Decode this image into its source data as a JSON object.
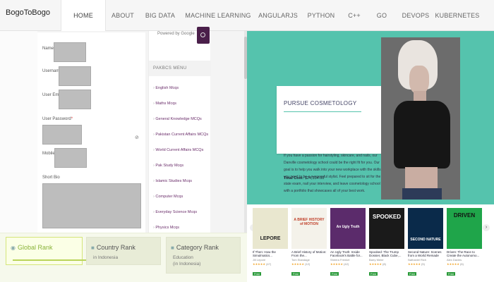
{
  "nav": {
    "brand": "BogoToBogo",
    "items": [
      {
        "label": "HOME",
        "active": true
      },
      {
        "label": "ABOUT"
      },
      {
        "label": "BIG DATA"
      },
      {
        "label": "MACHINE LEARNING"
      },
      {
        "label": "ANGULARJS"
      },
      {
        "label": "PYTHON"
      },
      {
        "label": "C++"
      },
      {
        "label": "GO"
      },
      {
        "label": "DEVOPS"
      },
      {
        "label": "KUBERNETES"
      }
    ]
  },
  "form": {
    "fields": [
      {
        "label": "Name",
        "required": true
      },
      {
        "label": "Username",
        "required": true
      },
      {
        "label": "User Email",
        "required": true
      },
      {
        "label": "User Password",
        "required": true
      },
      {
        "label": "Mobile",
        "required": true
      },
      {
        "label": "Short Bio",
        "required": false
      }
    ],
    "required_mark": "*"
  },
  "sidebar": {
    "search_text": "Powered by Google",
    "menu_title": "PAKBCS MENU",
    "items": [
      "English Mcqs",
      "Maths Mcqs",
      "General Knowledge MCQs",
      "Pakistan Current Affairs MCQs",
      "World Current Affairs MCQs",
      "Pak Study Mcqs",
      "Islamic Studies Mcqs",
      "Computer Mcqs",
      "Everyday Science Mcqs",
      "Physics Mcqs"
    ]
  },
  "ad": {
    "title": "PURSUE COSMETOLOGY",
    "text": "If you have a passion for hairstyling, skincare, and nails, our Danville cosmetology school could be the right fit for you. Our goal is to help you walk into your new workplace with the skills you need to be a successful stylist. Feel prepared to sit for the state exam, nail your interview, and leave cosmetology school with a portfolio that showcases all of your best work.",
    "cost_label": "Total Cost:",
    "cost_value": "$24,334.00",
    "colors": {
      "background": "#55c3ad"
    }
  },
  "books": {
    "prev_arrow": "‹",
    "next_arrow": "›",
    "items": [
      {
        "cover_text": "LEPORE",
        "title": "If Then: How the Simulmatics...",
        "author": "Jill Lepore",
        "rating": 4.5,
        "reviews": "(47)",
        "badge": "Free",
        "cover_color": "#e9e7cf"
      },
      {
        "cover_text": "A BRIEF HISTORY of MOTION",
        "title": "A Brief History of Motion: From the...",
        "author": "Tom Standage",
        "rating": 4.5,
        "reviews": "(12)",
        "badge": "Free",
        "cover_color": "#f4f2ea"
      },
      {
        "cover_text": "An Ugly Truth",
        "title": "An Ugly Truth: Inside Facebook's Battle for...",
        "author": "Sheera Frenkel",
        "rating": 4.5,
        "reviews": "(42)",
        "badge": "Free",
        "cover_color": "#5b2b6b"
      },
      {
        "cover_text": "SPOOKED",
        "title": "Spooked: The Trump Dossier, Black Cube,...",
        "author": "Barry Meier",
        "rating": 4.5,
        "reviews": "(8)",
        "badge": "Free",
        "cover_color": "#1a1a1a"
      },
      {
        "cover_text": "SECOND NATURE",
        "title": "Second Nature: Scenes from a World Remade",
        "author": "Nathaniel Rich",
        "rating": 4.5,
        "reviews": "(5)",
        "badge": "Free",
        "cover_color": "#0a2a4a"
      },
      {
        "cover_text": "DRIVEN",
        "title": "Driven: The Race to Create the Autonomo...",
        "author": "Alex Davies",
        "rating": 4.5,
        "reviews": "(6)",
        "badge": "Free",
        "cover_color": "#1fa54a"
      }
    ]
  },
  "ranks": {
    "global": {
      "label": "Global Rank"
    },
    "country": {
      "label": "Country Rank",
      "sub": "in Indonesia"
    },
    "category": {
      "label": "Category Rank",
      "sub1": "Education",
      "sub2": "(in Indonesia)"
    }
  }
}
